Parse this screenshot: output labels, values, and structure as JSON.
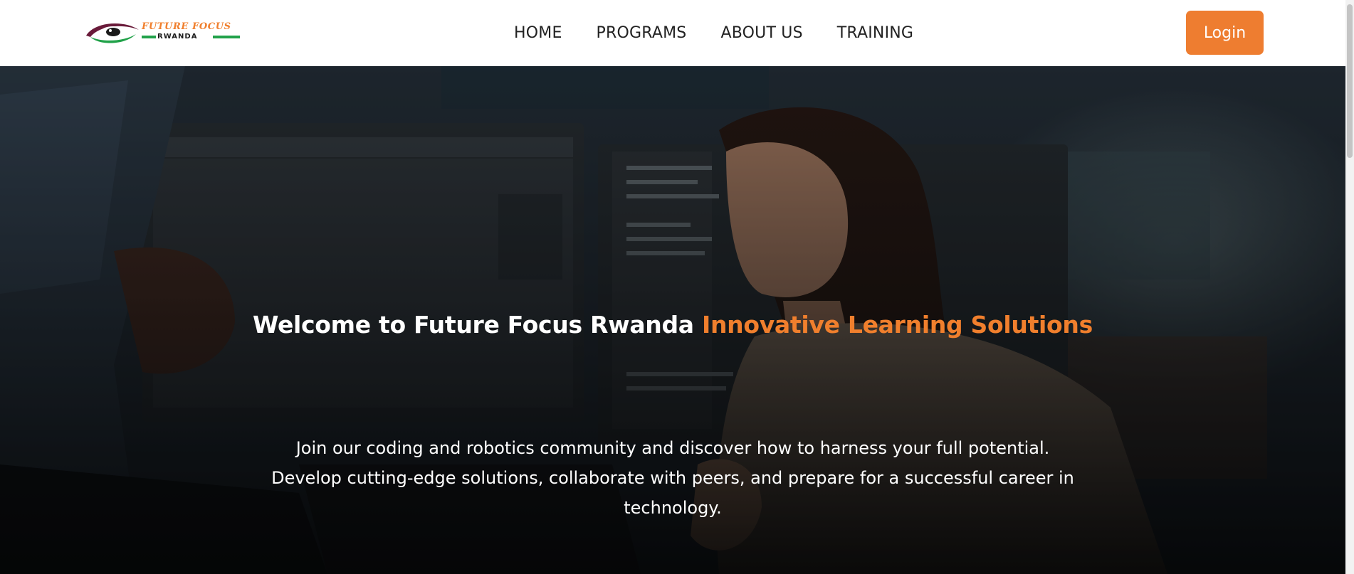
{
  "brand": {
    "name": "FUTURE FOCUS",
    "sub": "RWANDA",
    "accent_color": "#f07f2d",
    "green_color": "#22a24a"
  },
  "nav": {
    "items": [
      {
        "label": "HOME"
      },
      {
        "label": "PROGRAMS"
      },
      {
        "label": "ABOUT US"
      },
      {
        "label": "TRAINING"
      }
    ]
  },
  "header": {
    "login_label": "Login",
    "login_color": "#ee7d30"
  },
  "hero": {
    "title_main": "Welcome to Future Focus Rwanda",
    "title_accent": "Innovative Learning Solutions",
    "description": "Join our coding and robotics community and discover how to harness your full potential. Develop cutting-edge solutions, collaborate with peers, and prepare for a successful career in technology."
  }
}
